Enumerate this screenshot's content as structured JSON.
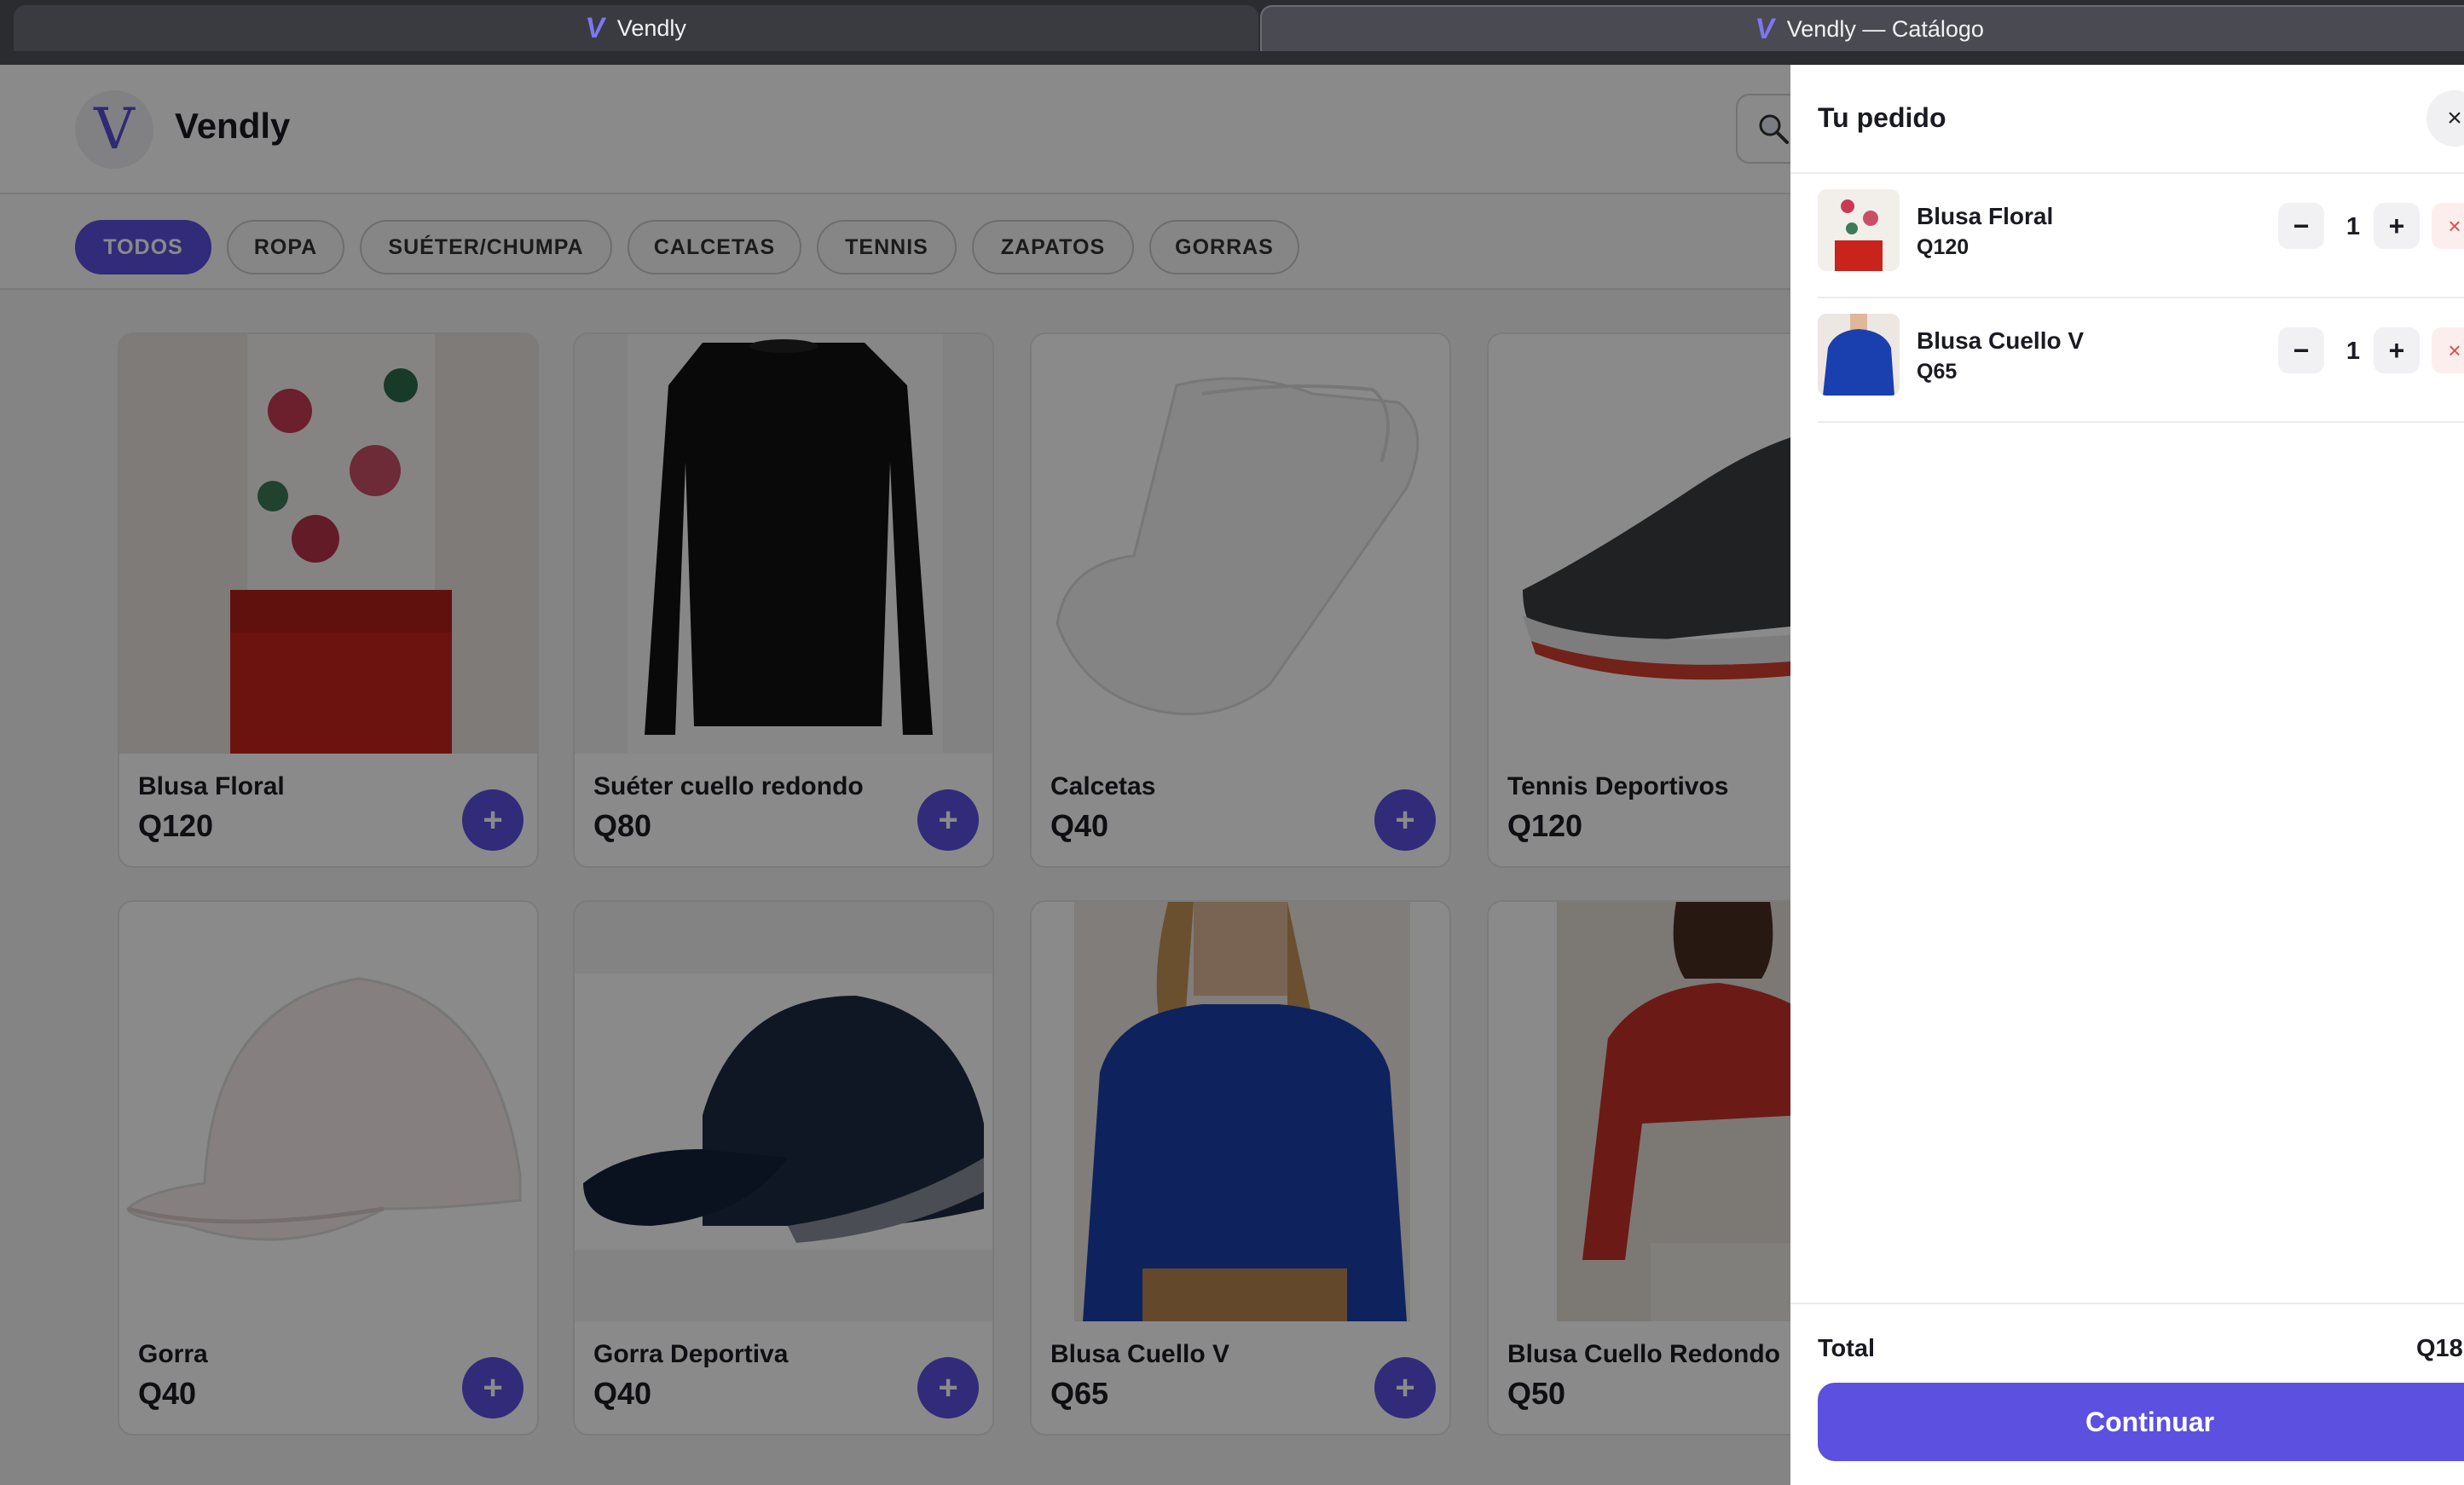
{
  "browser": {
    "tabs": [
      {
        "title": "Vendly",
        "icon": "vendly-logo"
      },
      {
        "title": "Vendly — Catálogo",
        "icon": "vendly-logo"
      }
    ]
  },
  "header": {
    "brand": "Vendly",
    "logo_letter": "V"
  },
  "categories": [
    "TODOS",
    "ROPA",
    "SUÉTER/CHUMPA",
    "CALCETAS",
    "TENNIS",
    "ZAPATOS",
    "GORRAS"
  ],
  "active_category": "TODOS",
  "products": [
    {
      "name": "Blusa Floral",
      "price": "Q120"
    },
    {
      "name": "Suéter cuello redondo",
      "price": "Q80"
    },
    {
      "name": "Calcetas",
      "price": "Q40"
    },
    {
      "name": "Tennis Deportivos",
      "price": "Q120"
    },
    {
      "name": "Gorra",
      "price": "Q40"
    },
    {
      "name": "Gorra Deportiva",
      "price": "Q40"
    },
    {
      "name": "Blusa Cuello V",
      "price": "Q65"
    },
    {
      "name": "Blusa Cuello Redondo",
      "price": "Q50"
    }
  ],
  "add_symbol": "+",
  "cart": {
    "title": "Tu pedido",
    "close_symbol": "×",
    "items": [
      {
        "name": "Blusa Floral",
        "price": "Q120",
        "qty": "1"
      },
      {
        "name": "Blusa Cuello V",
        "price": "Q65",
        "qty": "1"
      }
    ],
    "minus_symbol": "−",
    "plus_symbol": "+",
    "remove_symbol": "×",
    "total_label": "Total",
    "total_value": "Q18",
    "continue_label": "Continuar"
  },
  "colors": {
    "accent": "#5b50e0",
    "overlay": "rgba(0,0,0,0.46)"
  }
}
